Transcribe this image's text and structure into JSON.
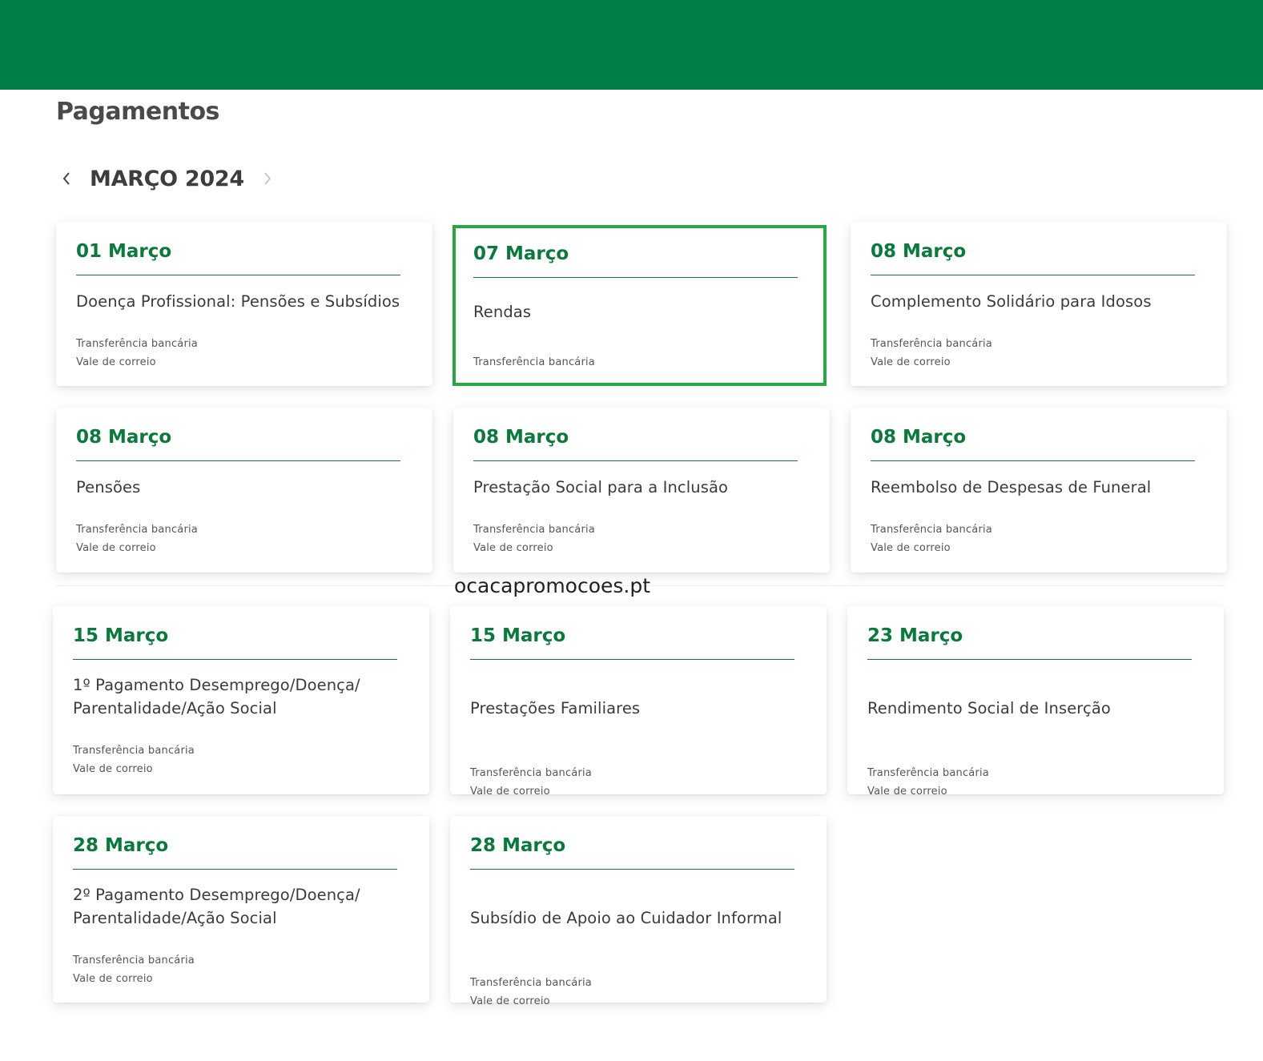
{
  "page": {
    "title": "Pagamentos",
    "watermark": "ocacapromocoes.pt"
  },
  "month_nav": {
    "label": "MARÇO 2024",
    "prev_icon": "chevron-left-icon",
    "next_icon": "chevron-right-icon"
  },
  "colors": {
    "brand_green": "#008046",
    "date_green": "#0a7a3c",
    "selected_border": "#27a845"
  },
  "payments": [
    {
      "date": "01 Março",
      "name": "Doença Profissional: Pensões e Subsídios",
      "methods": [
        "Transferência bancária",
        "Vale de correio"
      ],
      "selected": false
    },
    {
      "date": "07 Março",
      "name": "Rendas",
      "methods": [
        "Transferência bancária"
      ],
      "selected": true
    },
    {
      "date": "08 Março",
      "name": "Complemento Solidário para Idosos",
      "methods": [
        "Transferência bancária",
        "Vale de correio"
      ],
      "selected": false
    },
    {
      "date": "08 Março",
      "name": "Pensões",
      "methods": [
        "Transferência bancária",
        "Vale de correio"
      ],
      "selected": false
    },
    {
      "date": "08 Março",
      "name": "Prestação Social para a Inclusão",
      "methods": [
        "Transferência bancária",
        "Vale de correio"
      ],
      "selected": false
    },
    {
      "date": "08 Março",
      "name": "Reembolso de Despesas de Funeral",
      "methods": [
        "Transferência bancária",
        "Vale de correio"
      ],
      "selected": false
    },
    {
      "date": "15 Março",
      "name": "1º Pagamento Desemprego/Doença/ Parentalidade/Ação Social",
      "methods": [
        "Transferência bancária",
        "Vale de correio"
      ],
      "selected": false
    },
    {
      "date": "15 Março",
      "name": "Prestações Familiares",
      "methods": [
        "Transferência bancária",
        "Vale de correio"
      ],
      "selected": false
    },
    {
      "date": "23 Março",
      "name": "Rendimento Social de Inserção",
      "methods": [
        "Transferência bancária",
        "Vale de correio"
      ],
      "selected": false
    },
    {
      "date": "28 Março",
      "name": "2º Pagamento Desemprego/Doença/ Parentalidade/Ação Social",
      "methods": [
        "Transferência bancária",
        "Vale de correio"
      ],
      "selected": false
    },
    {
      "date": "28 Março",
      "name": "Subsídio de Apoio ao Cuidador Informal",
      "methods": [
        "Transferência bancária",
        "Vale de correio"
      ],
      "selected": false
    }
  ]
}
